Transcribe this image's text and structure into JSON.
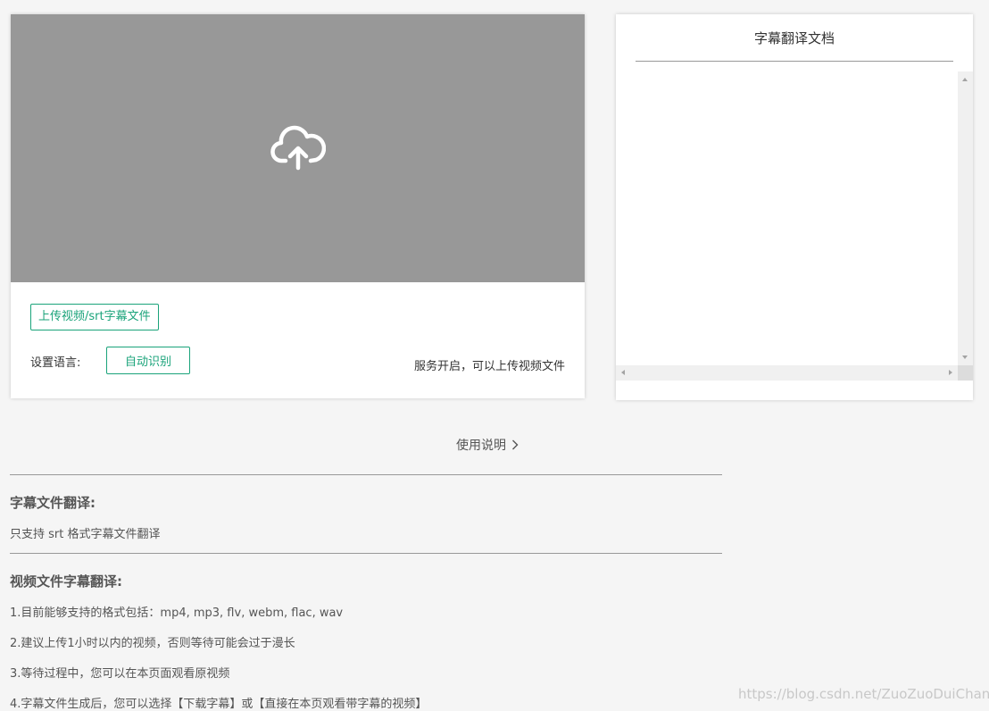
{
  "upload_card": {
    "upload_area_icon": "cloud-upload-icon",
    "upload_button_label": "上传视频/srt字幕文件",
    "language_label": "设置语言:",
    "language_button_label": "自动识别",
    "status_text": "服务开启，可以上传视频文件"
  },
  "doc_card": {
    "title": "字幕翻译文档",
    "content": ""
  },
  "help": {
    "link_label": "使用说明"
  },
  "instructions": {
    "subtitle_section_title": "字幕文件翻译:",
    "subtitle_section_text": "只支持 srt 格式字幕文件翻译",
    "video_section_title": "视频文件字幕翻译:",
    "video_items": [
      "1.目前能够支持的格式包括：mp4, mp3, flv, webm, flac, wav",
      "2.建议上传1小时以内的视频，否则等待可能会过于漫长",
      "3.等待过程中，您可以在本页面观看原视频",
      "4.字幕文件生成后，您可以选择【下载字幕】或【直接在本页观看带字幕的视频】"
    ]
  },
  "watermark": "https://blog.csdn.net/ZuoZuoDuiChang",
  "colors": {
    "accent": "#1aa37a",
    "upload_area_bg": "#989898",
    "page_bg": "#f5f5f5"
  }
}
